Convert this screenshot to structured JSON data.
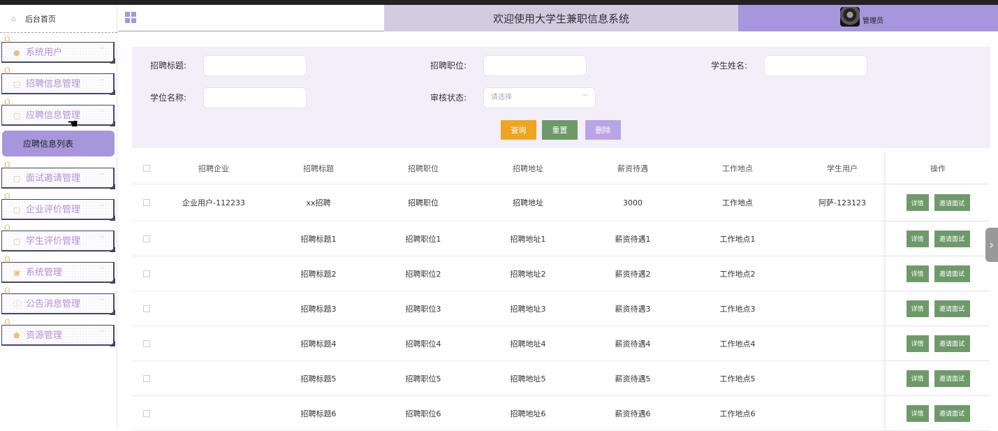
{
  "sidebar": {
    "home_label": "后台首页",
    "menu": [
      {
        "label": "系统用户",
        "icon": "user-icon"
      },
      {
        "label": "招聘信息管理",
        "icon": "doc-icon"
      },
      {
        "label": "应聘信息管理",
        "icon": "doc-icon"
      },
      {
        "label": "面试邀请管理",
        "icon": "doc-icon"
      },
      {
        "label": "企业评价管理",
        "icon": "doc-icon"
      },
      {
        "label": "学生评价管理",
        "icon": "doc-icon"
      },
      {
        "label": "系统管理",
        "icon": "image-icon"
      },
      {
        "label": "公告消息管理",
        "icon": "info-icon"
      },
      {
        "label": "资源管理",
        "icon": "shield-icon"
      }
    ],
    "submenu_label": "应聘信息列表"
  },
  "header": {
    "title": "欢迎使用大学生兼职信息系统",
    "user_name": "管理员",
    "accent": "#a796dc"
  },
  "filter": {
    "title_label": "招聘标题:",
    "position_label": "招聘职位:",
    "student_label": "学生姓名:",
    "degree_label": "学位名称:",
    "status_label": "审核状态:",
    "status_placeholder": "请选择",
    "query_btn": "查询",
    "reset_btn": "重置",
    "delete_btn": "删除"
  },
  "table": {
    "headers": [
      "招聘企业",
      "招聘标题",
      "招聘职位",
      "招聘地址",
      "薪资待遇",
      "工作地点",
      "学生用户",
      "操作"
    ],
    "detail_btn": "详情",
    "invite_btn": "邀请面试",
    "rows": [
      [
        "企业用户-112233",
        "xx招聘",
        "招聘职位",
        "招聘地址",
        "3000",
        "工作地点",
        "阿萨-123123"
      ],
      [
        "",
        "招聘标题1",
        "招聘职位1",
        "招聘地址1",
        "薪资待遇1",
        "工作地点1",
        ""
      ],
      [
        "",
        "招聘标题2",
        "招聘职位2",
        "招聘地址2",
        "薪资待遇2",
        "工作地点2",
        ""
      ],
      [
        "",
        "招聘标题3",
        "招聘职位3",
        "招聘地址3",
        "薪资待遇3",
        "工作地点3",
        ""
      ],
      [
        "",
        "招聘标题4",
        "招聘职位4",
        "招聘地址4",
        "薪资待遇4",
        "工作地点4",
        ""
      ],
      [
        "",
        "招聘标题5",
        "招聘职位5",
        "招聘地址5",
        "薪资待遇5",
        "工作地点5",
        ""
      ],
      [
        "",
        "招聘标题6",
        "招聘职位6",
        "招聘地址6",
        "薪资待遇6",
        "工作地点6",
        ""
      ]
    ]
  }
}
